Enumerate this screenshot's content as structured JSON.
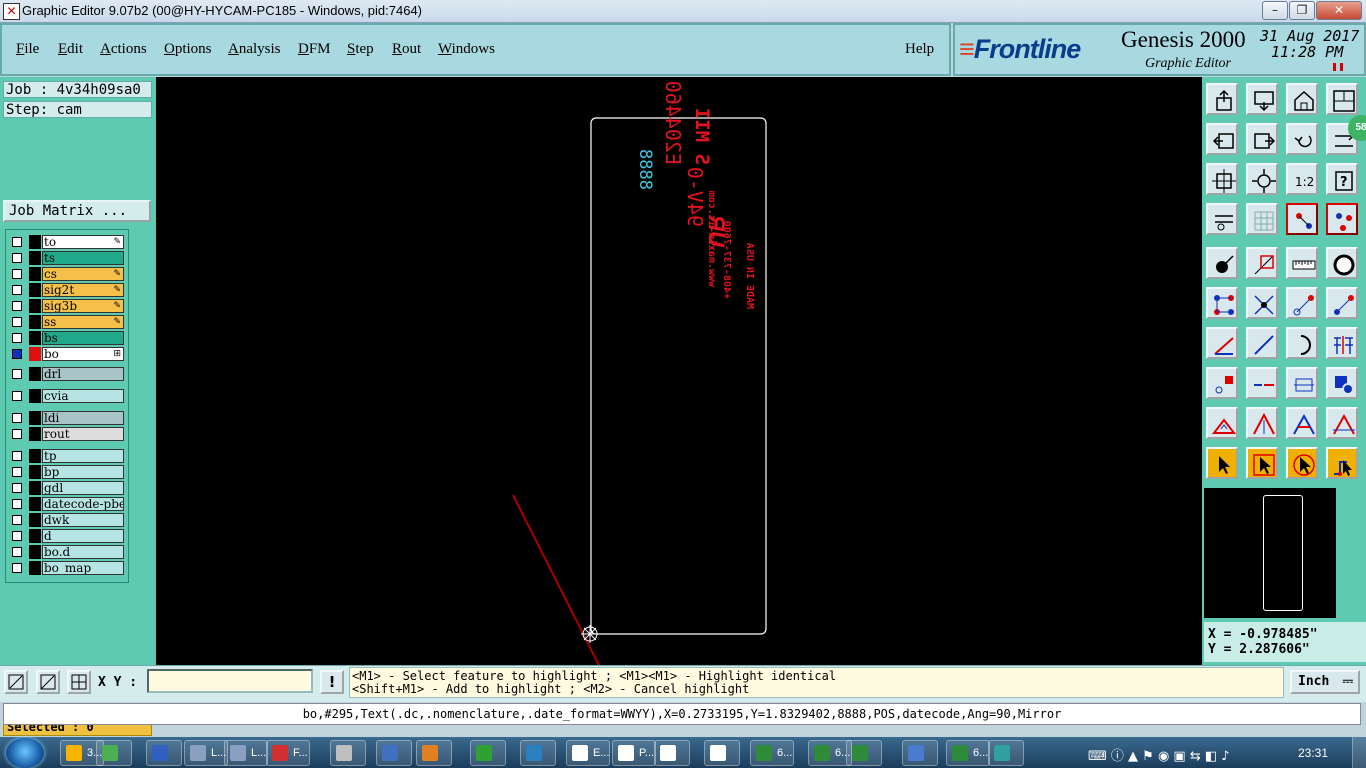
{
  "window": {
    "title": "Graphic Editor 9.07b2 (00@HY-HYCAM-PC185 - Windows, pid:7464)",
    "controls": [
      "minimize",
      "maximize",
      "close"
    ]
  },
  "menu": {
    "items": [
      {
        "label": "File",
        "hotkey": "F",
        "rest": "ile"
      },
      {
        "label": "Edit",
        "hotkey": "E",
        "rest": "dit"
      },
      {
        "label": "Actions",
        "hotkey": "A",
        "rest": "ctions"
      },
      {
        "label": "Options",
        "hotkey": "O",
        "rest": "ptions"
      },
      {
        "label": "Analysis",
        "hotkey": "A",
        "rest": "nalysis"
      },
      {
        "label": "DFM",
        "hotkey": "D",
        "rest": "FM"
      },
      {
        "label": "Step",
        "hotkey": "S",
        "rest": "tep"
      },
      {
        "label": "Rout",
        "hotkey": "R",
        "rest": "out"
      },
      {
        "label": "Windows",
        "hotkey": "W",
        "rest": "indows"
      }
    ],
    "help": "Help"
  },
  "brand": {
    "logo": "Frontline",
    "product": "Genesis 2000",
    "subtitle": "Graphic Editor",
    "date": "31 Aug 2017",
    "time": "11:28 PM"
  },
  "job": {
    "job_label": "Job : 4v34h09sa0",
    "step_label": "Step: cam",
    "matrix_button": "Job Matrix ..."
  },
  "layers": [
    {
      "name": "to",
      "color": "#ffffff",
      "flag": "✎",
      "group": 0
    },
    {
      "name": "ts",
      "color": "#1fa88a",
      "flag": "",
      "group": 0
    },
    {
      "name": "cs",
      "color": "#f5c04a",
      "flag": "✎",
      "group": 0
    },
    {
      "name": "sig2t",
      "color": "#f5c04a",
      "flag": "✎",
      "group": 0
    },
    {
      "name": "sig3b",
      "color": "#f5c04a",
      "flag": "✎",
      "group": 0
    },
    {
      "name": "ss",
      "color": "#f5c04a",
      "flag": "✎",
      "group": 0
    },
    {
      "name": "bs",
      "color": "#1fa88a",
      "flag": "",
      "group": 0
    },
    {
      "name": "bo",
      "color": "#ffffff",
      "flag": "⊞",
      "group": 0,
      "active": true
    },
    {
      "name": "drl",
      "color": "#a9c4c8",
      "flag": "",
      "group": 1
    },
    {
      "name": "cvia",
      "color": "#b6e4e4",
      "flag": "",
      "group": 2
    },
    {
      "name": "ldi",
      "color": "#a9c4c8",
      "flag": "",
      "group": 3
    },
    {
      "name": "rout",
      "color": "#dcdcdc",
      "flag": "",
      "group": 3
    },
    {
      "name": "tp",
      "color": "#b6e4e4",
      "flag": "",
      "group": 4
    },
    {
      "name": "bp",
      "color": "#b6e4e4",
      "flag": "",
      "group": 4
    },
    {
      "name": "gdl",
      "color": "#b6e4e4",
      "flag": "",
      "group": 4
    },
    {
      "name": "datecode-pbe",
      "color": "#b6e4e4",
      "flag": "",
      "group": 4
    },
    {
      "name": "dwk",
      "color": "#b6e4e4",
      "flag": "",
      "group": 4
    },
    {
      "name": "d",
      "color": "#b6e4e4",
      "flag": "",
      "group": 4
    },
    {
      "name": "bo.d",
      "color": "#b6e4e4",
      "flag": "",
      "group": 4
    },
    {
      "name": "bo_map",
      "color": "#b6e4e4",
      "flag": "",
      "group": 4
    }
  ],
  "selected": "Selected : 0",
  "canvas": {
    "board_text": {
      "ul_number": "E204460",
      "ul_rating": "94V-0",
      "ul_code": "S MII",
      "datecode": "8888",
      "website": "www.maxim-ic.com",
      "phone": "+408-737-7600",
      "origin": "MADE IN USA"
    }
  },
  "tools": [
    "zoom-home-icon",
    "snapshot-icon",
    "home-view-icon",
    "window-layout-icon",
    "pan-left-icon",
    "pan-right-icon",
    "undo-view-icon",
    "fit-icon",
    "zoom-fit-icon",
    "zoom-center-icon",
    "scale-1-2-icon",
    "query-icon",
    "settings-icon",
    "grid-icon",
    "snap-red-icon",
    "snap-red2-icon",
    "pad-icon",
    "select-area-icon",
    "ruler-icon",
    "circle-icon",
    "connect-nodes-icon",
    "delete-node-icon",
    "move-point-icon",
    "add-point-icon",
    "line-angle-icon",
    "line-draw-icon",
    "arc-icon",
    "fence-icon",
    "move-feature-icon",
    "dash-line-icon",
    "measure-icon",
    "copy-shape-icon",
    "triangle-small-icon",
    "triangle-up-icon",
    "triangle-mid-icon",
    "triangle-spread-icon",
    "pointer-icon",
    "pointer-select-icon",
    "pointer-rotate-icon",
    "pointer-route-icon"
  ],
  "coordinates": {
    "x": "X = -0.978485\"",
    "y": "Y = 2.287606\""
  },
  "bottom": {
    "xy_label": "X Y :",
    "xy_value": "",
    "excl": "!",
    "hint1": "<M1> - Select feature to highlight ; <M1><M1> - Highlight identical",
    "hint2": "<Shift+M1> - Add to highlight ; <M2> - Cancel highlight",
    "units": "Inch"
  },
  "status_line": "bo,#295,Text(.dc,.nomenclature,.date_format=WWYY),X=0.2733195,Y=1.8329402,8888,POS,datecode,Ang=90,Mirror",
  "taskbar": {
    "items": [
      {
        "label": "3...",
        "color": "#f7b500"
      },
      {
        "label": "",
        "color": "#4caf50"
      },
      {
        "label": "",
        "color": "#3060c0"
      },
      {
        "label": "L...",
        "color": "#8aa0c0"
      },
      {
        "label": "L...",
        "color": "#8aa0c0"
      },
      {
        "label": "F...",
        "color": "#d03030"
      },
      {
        "label": "",
        "color": "#c0c0c0"
      },
      {
        "label": "",
        "color": "#4070c0"
      },
      {
        "label": "",
        "color": "#e08020"
      },
      {
        "label": "",
        "color": "#30a030"
      },
      {
        "label": "",
        "color": "#2a80c0"
      },
      {
        "label": "E...",
        "color": "#ffffff"
      },
      {
        "label": "P...",
        "color": "#ffffff"
      },
      {
        "label": "",
        "color": "#ffffff"
      },
      {
        "label": "",
        "color": "#ffffff"
      },
      {
        "label": "6...",
        "color": "#2e8b3a"
      },
      {
        "label": "6...",
        "color": "#2e8b3a"
      },
      {
        "label": "",
        "color": "#2e8b3a"
      },
      {
        "label": "",
        "color": "#4a7bd0"
      },
      {
        "label": "6...",
        "color": "#2e8b3a"
      },
      {
        "label": "",
        "color": "#30a0a0"
      }
    ],
    "clock": "23:31"
  }
}
